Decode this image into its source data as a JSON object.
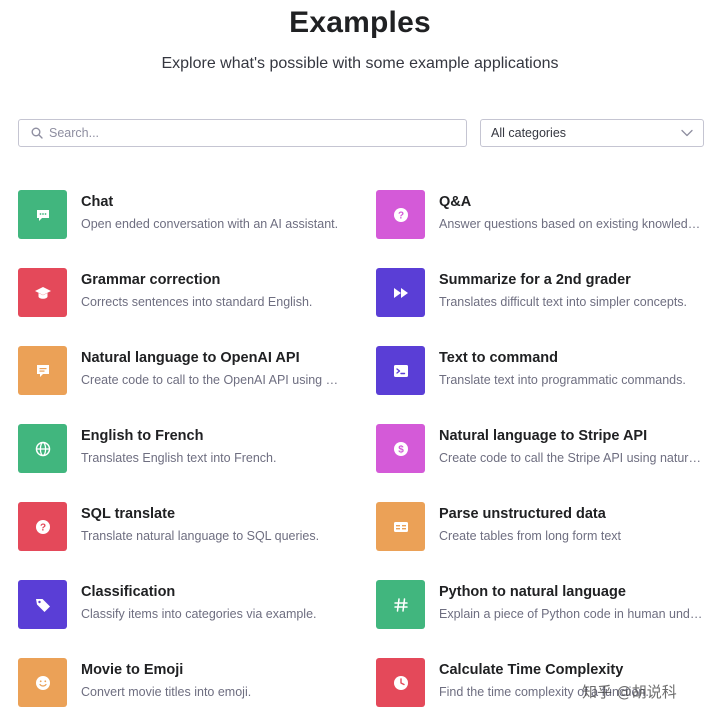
{
  "header": {
    "title": "Examples",
    "subtitle": "Explore what's possible with some example applications"
  },
  "search": {
    "placeholder": "Search..."
  },
  "category_select": {
    "value": "All categories"
  },
  "examples": [
    {
      "title": "Chat",
      "desc": "Open ended conversation with an AI assistant.",
      "color": "#41b67e",
      "icon": "chat-bubble-icon"
    },
    {
      "title": "Q&A",
      "desc": "Answer questions based on existing knowledge.",
      "color": "#d45ad8",
      "icon": "question-icon"
    },
    {
      "title": "Grammar correction",
      "desc": "Corrects sentences into standard English.",
      "color": "#e4495a",
      "icon": "graduation-cap-icon"
    },
    {
      "title": "Summarize for a 2nd grader",
      "desc": "Translates difficult text into simpler concepts.",
      "color": "#5a3ed6",
      "icon": "fast-forward-icon"
    },
    {
      "title": "Natural language to OpenAI API",
      "desc": "Create code to call to the OpenAI API using a natural language instruction.",
      "color": "#eba157",
      "icon": "message-box-icon"
    },
    {
      "title": "Text to command",
      "desc": "Translate text into programmatic commands.",
      "color": "#5a3ed6",
      "icon": "terminal-icon"
    },
    {
      "title": "English to French",
      "desc": "Translates English text into French.",
      "color": "#41b67e",
      "icon": "globe-icon"
    },
    {
      "title": "Natural language to Stripe API",
      "desc": "Create code to call the Stripe API using natural language.",
      "color": "#d45ad8",
      "icon": "dollar-icon"
    },
    {
      "title": "SQL translate",
      "desc": "Translate natural language to SQL queries.",
      "color": "#e4495a",
      "icon": "question-icon"
    },
    {
      "title": "Parse unstructured data",
      "desc": "Create tables from long form text",
      "color": "#eba157",
      "icon": "table-icon"
    },
    {
      "title": "Classification",
      "desc": "Classify items into categories via example.",
      "color": "#5a3ed6",
      "icon": "tag-icon"
    },
    {
      "title": "Python to natural language",
      "desc": "Explain a piece of Python code in human understandable language.",
      "color": "#41b67e",
      "icon": "hash-icon"
    },
    {
      "title": "Movie to Emoji",
      "desc": "Convert movie titles into emoji.",
      "color": "#eba157",
      "icon": "smiley-icon"
    },
    {
      "title": "Calculate Time Complexity",
      "desc": "Find the time complexity of a function.",
      "color": "#e4495a",
      "icon": "clock-icon"
    }
  ],
  "watermark": {
    "text": "知乎 @胡说科"
  }
}
